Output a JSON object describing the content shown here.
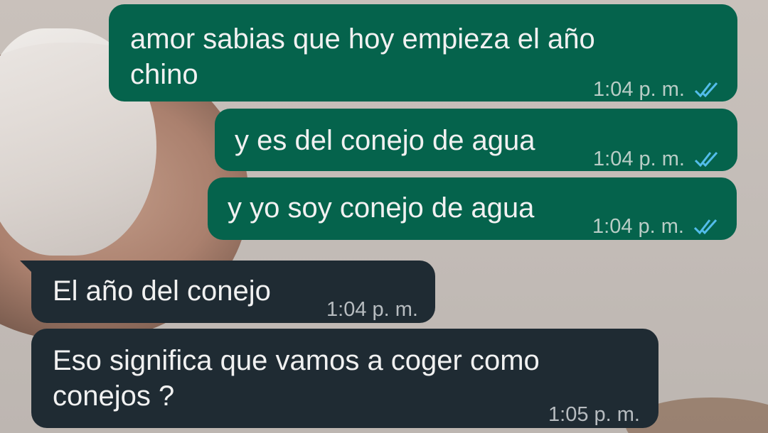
{
  "chat": {
    "messages": [
      {
        "direction": "outgoing",
        "text": "amor sabias que hoy empieza el año\nchino",
        "time": "1:04 p. m.",
        "status_icon": "double-check-read-icon"
      },
      {
        "direction": "outgoing",
        "text": "y es del conejo de agua",
        "time": "1:04 p. m.",
        "status_icon": "double-check-read-icon"
      },
      {
        "direction": "outgoing",
        "text": "y yo soy conejo de agua",
        "time": "1:04 p. m.",
        "status_icon": "double-check-read-icon"
      },
      {
        "direction": "incoming",
        "text": "El año del conejo",
        "time": "1:04 p. m."
      },
      {
        "direction": "incoming",
        "text": "Eso significa que vamos a coger como\nconejos ?",
        "time": "1:05 p. m."
      }
    ]
  },
  "colors": {
    "outgoing_bubble": "#05634c",
    "incoming_bubble": "#1f2b33",
    "read_tick": "#53bdeb"
  }
}
